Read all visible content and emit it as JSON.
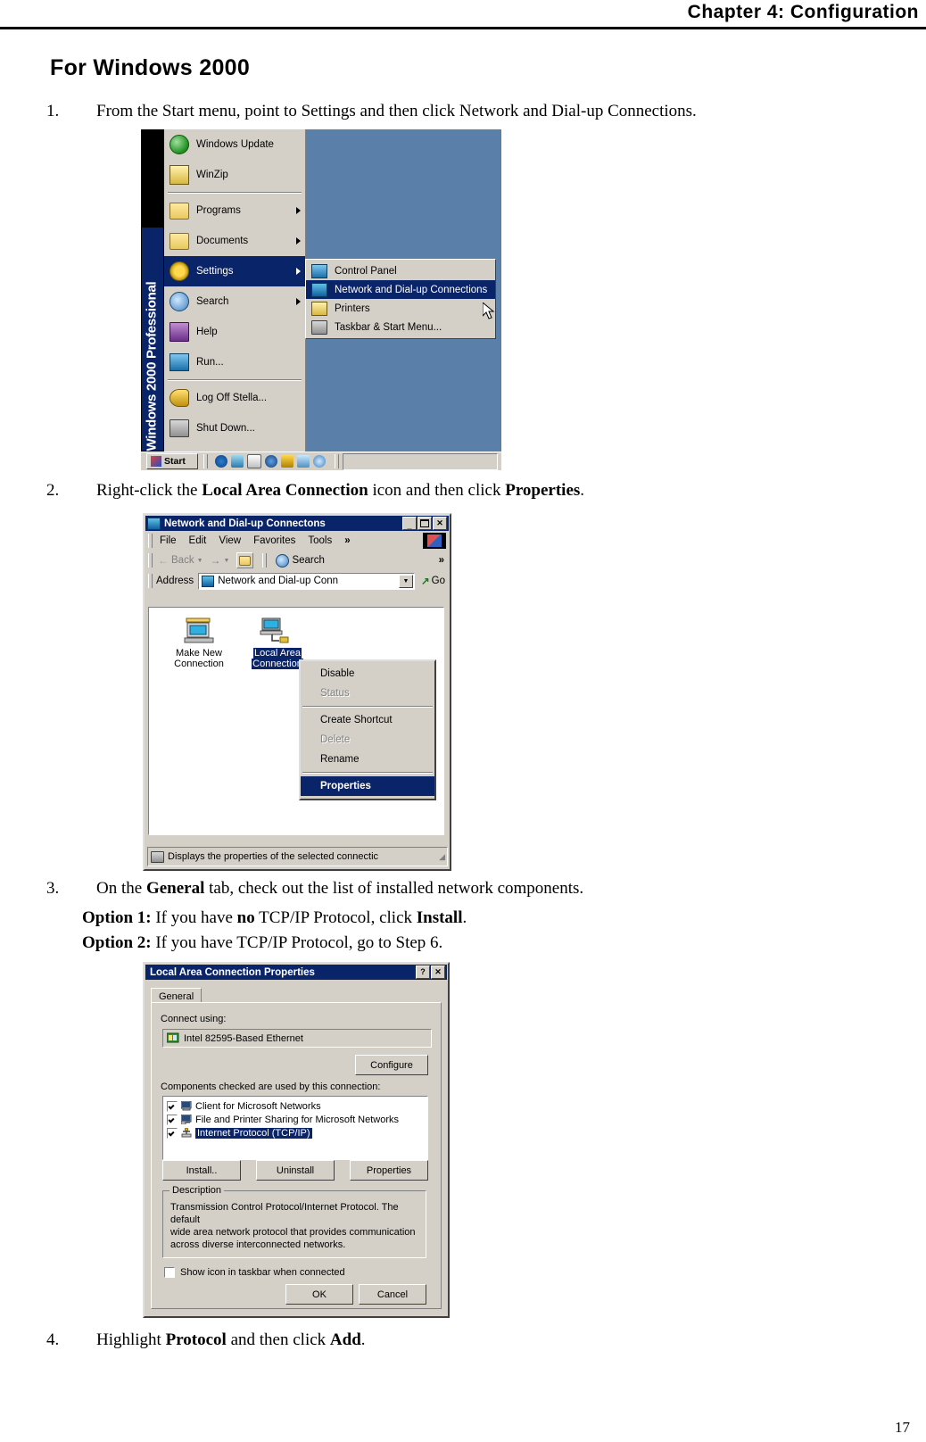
{
  "page": {
    "chapter_header": "Chapter 4: Configuration",
    "page_number": "17",
    "section_heading": "For Windows 2000"
  },
  "steps": {
    "step1": {
      "number": "1.",
      "text": "From the Start menu, point to Settings and then click Network and Dial-up Connections."
    },
    "step2": {
      "number": "2.",
      "prefix": "Right-click the ",
      "bold1": "Local Area Connection",
      "middle": " icon and then click ",
      "bold2": "Properties",
      "suffix": "."
    },
    "step3": {
      "number": "3.",
      "prefix": " On the ",
      "bold1": "General",
      "suffix": " tab, check out the list of installed network components.",
      "option1_label": "Option 1:",
      "option1_a": " If you have ",
      "option1_bold": "no",
      "option1_b": " TCP/IP Protocol, click ",
      "option1_boldend": "Install",
      "option1_end": ".",
      "option2_label": "Option 2:",
      "option2_text": " If you have TCP/IP Protocol, go to Step 6."
    },
    "step4": {
      "number": "4.",
      "prefix": "Highlight ",
      "bold1": "Protocol",
      "middle": " and then click ",
      "bold2": "Add",
      "suffix": "."
    }
  },
  "start_menu": {
    "brand": "Windows 2000 Professional",
    "items": [
      {
        "label": "Windows Update",
        "icon": "globe-icon",
        "arrow": false,
        "selected": false
      },
      {
        "label": "WinZip",
        "icon": "winzip-icon",
        "arrow": false,
        "selected": false
      },
      {
        "label": "Programs",
        "icon": "programs-folder-icon",
        "arrow": true,
        "selected": false
      },
      {
        "label": "Documents",
        "icon": "documents-folder-icon",
        "arrow": true,
        "selected": false
      },
      {
        "label": "Settings",
        "icon": "settings-gear-icon",
        "arrow": true,
        "selected": true
      },
      {
        "label": "Search",
        "icon": "search-icon",
        "arrow": true,
        "selected": false
      },
      {
        "label": "Help",
        "icon": "help-book-icon",
        "arrow": false,
        "selected": false
      },
      {
        "label": "Run...",
        "icon": "run-icon",
        "arrow": false,
        "selected": false
      },
      {
        "label": "Log Off Stella...",
        "icon": "logoff-key-icon",
        "arrow": false,
        "selected": false
      },
      {
        "label": "Shut Down...",
        "icon": "shutdown-monitor-icon",
        "arrow": false,
        "selected": false
      }
    ],
    "submenu": [
      {
        "label": "Control Panel",
        "icon": "control-panel-icon",
        "selected": false
      },
      {
        "label": "Network and Dial-up Connections",
        "icon": "network-connections-icon",
        "selected": true
      },
      {
        "label": "Printers",
        "icon": "printers-icon",
        "selected": false
      },
      {
        "label": "Taskbar & Start Menu...",
        "icon": "taskbar-icon",
        "selected": false
      }
    ],
    "taskbar": {
      "start_label": "Start",
      "quicklaunch": [
        "internet-explorer-icon",
        "show-desktop-icon",
        "outlook-express-icon",
        "media-icon",
        "tweak-icon",
        "mail-icon",
        "search-icon"
      ]
    }
  },
  "connections_window": {
    "title": "Network and Dial-up Connectons",
    "title_icon": "network-folder-icon",
    "window_buttons": {
      "minimize": "_",
      "maximize": "❐",
      "close": "✕"
    },
    "menus": [
      "File",
      "Edit",
      "View",
      "Favorites",
      "Tools"
    ],
    "menu_overflow": "»",
    "toolbar": {
      "back": "Back",
      "forward": "→",
      "up": "↑",
      "search": "Search",
      "overflow": "»"
    },
    "address": {
      "label": "Address",
      "value": "Network and Dial-up Conn",
      "go_label": "Go"
    },
    "icons": [
      {
        "label_line1": "Make New",
        "label_line2": "Connection",
        "icon": "make-new-connection-icon",
        "selected": false
      },
      {
        "label_line1": "Local Area",
        "label_line2": "Connection",
        "icon": "local-area-connection-icon",
        "selected": true
      }
    ],
    "context_menu": [
      {
        "label": "Disable",
        "state": "normal"
      },
      {
        "label": "Status",
        "state": "disabled"
      },
      {
        "separator": true
      },
      {
        "label": "Create Shortcut",
        "state": "normal"
      },
      {
        "label": "Delete",
        "state": "disabled"
      },
      {
        "label": "Rename",
        "state": "normal"
      },
      {
        "separator": true
      },
      {
        "label": "Properties",
        "state": "highlighted"
      }
    ],
    "status_text": "Displays the properties of the selected connectic"
  },
  "properties_dialog": {
    "title": "Local Area Connection Properties",
    "title_buttons": {
      "help": "?",
      "close": "✕"
    },
    "tab": "General",
    "connect_using_label": "Connect using:",
    "adapter": "Intel 82595-Based Ethernet",
    "adapter_icon": "network-adapter-icon",
    "configure_button": "Configure",
    "components_label": "Components checked are used by this connection:",
    "components": [
      {
        "label": "Client for Microsoft Networks",
        "checked": true,
        "selected": false,
        "icon": "client-icon"
      },
      {
        "label": "File and Printer Sharing for Microsoft Networks",
        "checked": true,
        "selected": false,
        "icon": "sharing-icon"
      },
      {
        "label": "Internet Protocol (TCP/IP)",
        "checked": true,
        "selected": true,
        "icon": "protocol-icon"
      }
    ],
    "buttons": {
      "install": "Install..",
      "uninstall": "Uninstall",
      "properties": "Properties"
    },
    "description_label": "Description",
    "description_lines": [
      "Transmission Control Protocol/Internet Protocol. The default",
      "wide area network protocol that provides communication",
      "across diverse interconnected networks."
    ],
    "checkbox_label": "Show icon in taskbar when connected",
    "checkbox_checked": false,
    "ok_button": "OK",
    "cancel_button": "Cancel"
  }
}
